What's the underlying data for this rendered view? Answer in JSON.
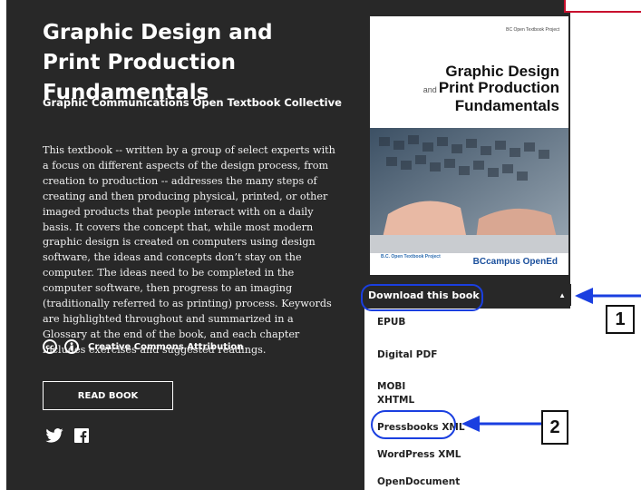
{
  "book": {
    "title": "Graphic Design and Print Production Fundamentals",
    "author": "Graphic Communications Open Textbook Collective",
    "description": "This textbook -- written by a group of select experts with a focus on different aspects of the design process, from creation to production -- addresses the many steps of creating and then producing physical, printed, or other imaged products that people interact with on a daily basis. It covers the concept that, while most modern graphic design is created on computers using design software, the ideas and concepts don’t stay on the computer. The ideas need to be completed in the computer software, then progress to an imaging (traditionally referred to as printing) process. Keywords are highlighted throughout and summarized in a Glossary at the end of the book, and each chapter includes exercises and suggested readings.",
    "license_label": "Creative Commons Attribution",
    "read_button": "READ BOOK"
  },
  "cover": {
    "project_label": "BC Open Textbook Project",
    "title_line1": "Graphic Design",
    "title_and": "and",
    "title_line2": "Print Production",
    "title_line3": "Fundamentals",
    "footer_left": "B.C. Open Textbook Project",
    "footer_right": "BCcampus OpenEd"
  },
  "download": {
    "header": "Download this book",
    "items": [
      "EPUB",
      "Digital PDF",
      "MOBI",
      "XHTML",
      "Pressbooks XML",
      "WordPress XML",
      "OpenDocument"
    ]
  },
  "annotations": {
    "marker1": "1",
    "marker2": "2",
    "accent_color": "#1a3fe0"
  },
  "icons": {
    "license": [
      "cc-icon",
      "attribution-icon"
    ],
    "social": [
      "twitter-icon",
      "facebook-icon"
    ]
  }
}
